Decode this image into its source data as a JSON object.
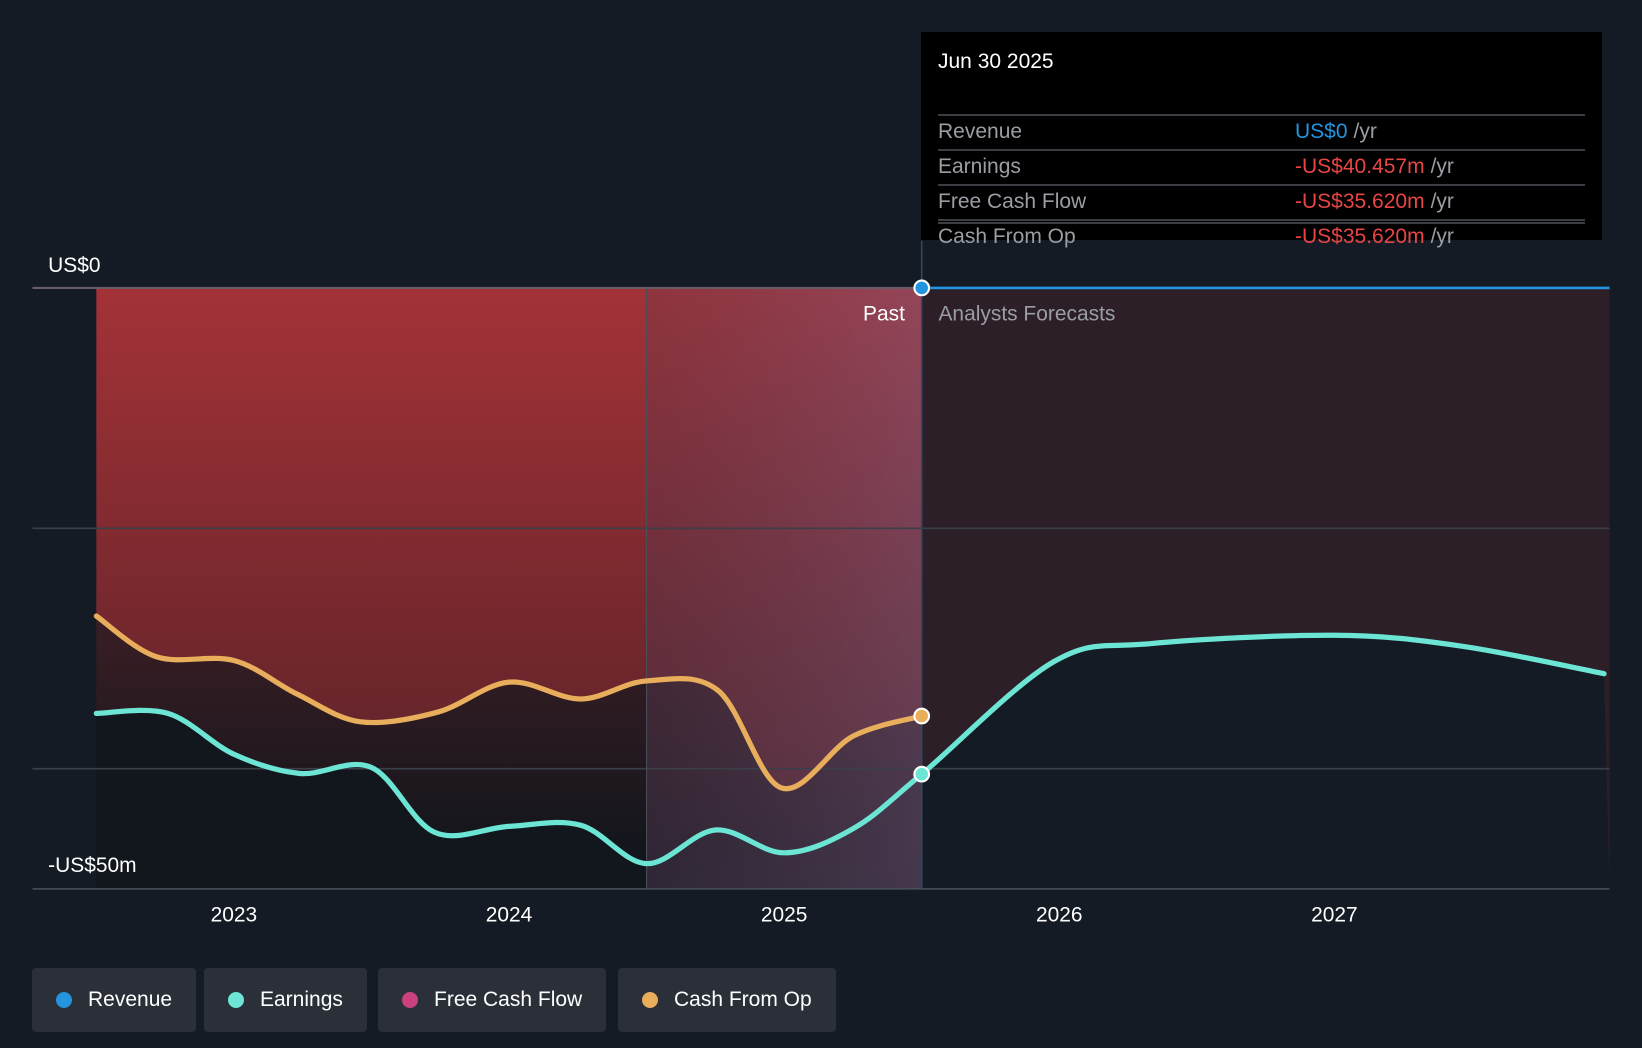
{
  "chart_data": {
    "type": "line",
    "y_axis": {
      "top_label": "US$0",
      "bottom_label": "-US$50m",
      "ylim": [
        -50,
        0
      ],
      "gridlines": [
        0,
        -20,
        -40
      ]
    },
    "x_axis": {
      "ticks": [
        "2023",
        "2024",
        "2025",
        "2026",
        "2027"
      ],
      "tick_values": [
        2023,
        2024,
        2025,
        2026,
        2027
      ],
      "xlim": [
        2022.5,
        2028.0
      ]
    },
    "past_label": "Past",
    "forecast_label": "Analysts Forecasts",
    "past_end": 2025.5,
    "series": [
      {
        "name": "Revenue",
        "color": "#2394df",
        "x": [
          2022.5,
          2025.5,
          2028.0
        ],
        "values": [
          0,
          0,
          0
        ]
      },
      {
        "name": "Earnings",
        "color": "#6ce5d4",
        "x": [
          2022.5,
          2022.76,
          2023.0,
          2023.24,
          2023.5,
          2023.73,
          2024.0,
          2024.26,
          2024.5,
          2024.75,
          2025.0,
          2025.25,
          2025.5,
          2025.98,
          2026.33,
          2027.0,
          2027.46,
          2027.98
        ],
        "values": [
          -35.4,
          -35.4,
          -38.8,
          -40.4,
          -39.9,
          -45.3,
          -44.8,
          -44.7,
          -47.9,
          -45.1,
          -47.0,
          -45.0,
          -40.457,
          -31.1,
          -29.6,
          -28.9,
          -29.8,
          -32.1
        ]
      },
      {
        "name": "Free Cash Flow",
        "color": "#c9427f",
        "x": [
          2022.5,
          2022.72,
          2023.0,
          2023.23,
          2023.46,
          2023.74,
          2024.0,
          2024.26,
          2024.5,
          2024.76,
          2024.99,
          2025.25,
          2025.5
        ],
        "values": [
          -27.3,
          -30.7,
          -31.0,
          -33.8,
          -36.1,
          -35.3,
          -32.8,
          -34.2,
          -32.7,
          -33.5,
          -41.6,
          -37.3,
          -35.62
        ]
      },
      {
        "name": "Cash From Op",
        "color": "#e8ae5b",
        "x": [
          2022.5,
          2022.72,
          2023.0,
          2023.23,
          2023.46,
          2023.74,
          2024.0,
          2024.26,
          2024.5,
          2024.76,
          2024.99,
          2025.25,
          2025.5
        ],
        "values": [
          -27.3,
          -30.7,
          -31.0,
          -33.8,
          -36.1,
          -35.3,
          -32.8,
          -34.2,
          -32.7,
          -33.5,
          -41.6,
          -37.3,
          -35.62
        ]
      }
    ]
  },
  "tooltip": {
    "date": "Jun 30 2025",
    "unit": "/yr",
    "rows": [
      {
        "label": "Revenue",
        "value": "US$0",
        "color": "#2394df"
      },
      {
        "label": "Earnings",
        "value": "-US$40.457m",
        "color": "#e84545"
      },
      {
        "label": "Free Cash Flow",
        "value": "-US$35.620m",
        "color": "#e84545"
      },
      {
        "label": "Cash From Op",
        "value": "-US$35.620m",
        "color": "#e84545"
      }
    ]
  },
  "legend": [
    {
      "label": "Revenue",
      "color": "#2394df"
    },
    {
      "label": "Earnings",
      "color": "#6ce5d4"
    },
    {
      "label": "Free Cash Flow",
      "color": "#c9427f"
    },
    {
      "label": "Cash From Op",
      "color": "#e8ae5b"
    }
  ]
}
